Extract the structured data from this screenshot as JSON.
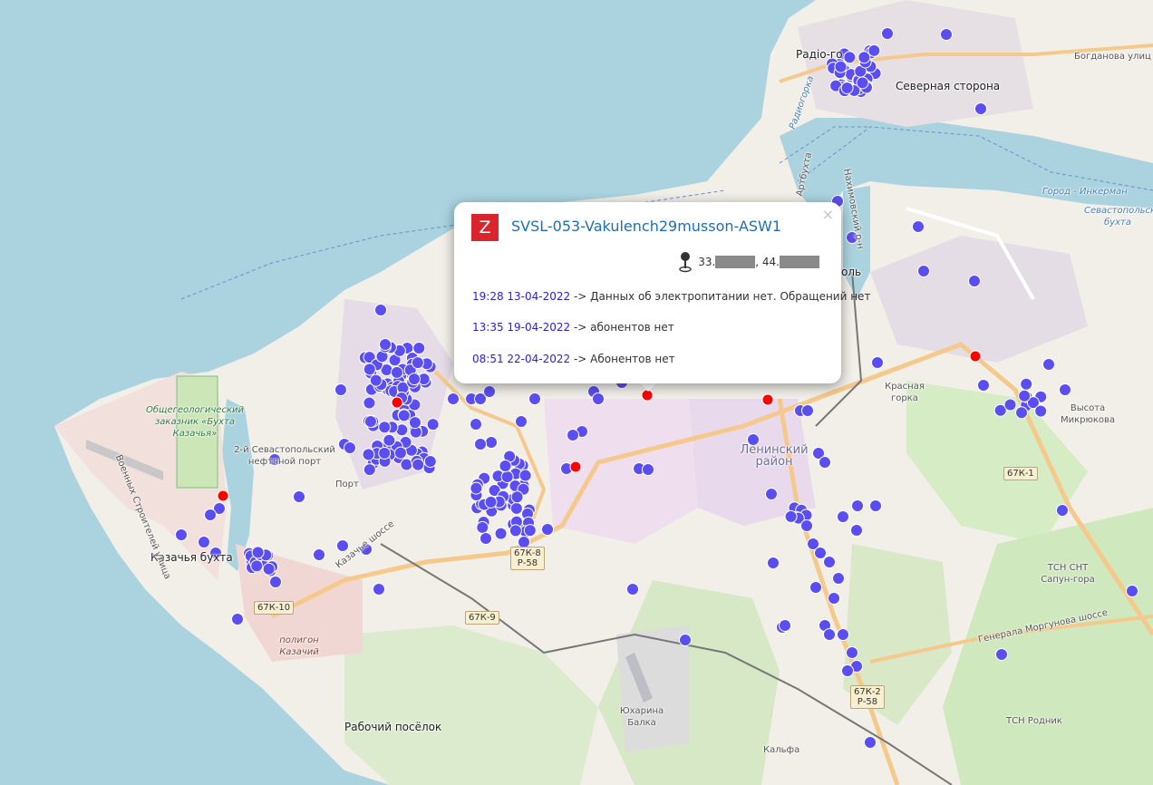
{
  "map": {
    "place_labels": [
      {
        "id": "radio-gorka",
        "text": "Радіо-го"
      },
      {
        "id": "severnaya-storona",
        "text": "Северная сторона"
      },
      {
        "id": "bogdanova",
        "text": "Богданова улиц"
      },
      {
        "id": "gorod-inkerman",
        "text": "Город - Инкерман"
      },
      {
        "id": "sevastopolskaya-bukhta",
        "text": "Севастопольская бухта"
      },
      {
        "id": "radiogorka-road",
        "text": "Радиогорка"
      },
      {
        "id": "arbukhta",
        "text": "Артбухта"
      },
      {
        "id": "nakhimovsky",
        "text": "Нахимовский р-н"
      },
      {
        "id": "sevastopol-partial",
        "text": "оль"
      },
      {
        "id": "krasnaya-gorka",
        "text": "Красная горка"
      },
      {
        "id": "vysota-mikryukova",
        "text": "Высота Микрюкова"
      },
      {
        "id": "leninsky",
        "text": "Ленинский район"
      },
      {
        "id": "zakaznik",
        "text": "Общегеологический заказник «Бухта Казачья»"
      },
      {
        "id": "port-2",
        "text": "2-й Севастопольский нефтяной порт"
      },
      {
        "id": "port",
        "text": "Порт"
      },
      {
        "id": "kazachya-bukhta",
        "text": "Казачья бухта"
      },
      {
        "id": "poligon",
        "text": "полигон Казачий"
      },
      {
        "id": "rabochy",
        "text": "Рабочий посёлок"
      },
      {
        "id": "yukharina",
        "text": "Юхарина Балка"
      },
      {
        "id": "kalfa",
        "text": "Кальфа"
      },
      {
        "id": "tsn-sapun",
        "text": "ТСН СНТ Сапун-гора"
      },
      {
        "id": "tsn-rodnik",
        "text": "ТСН Родник"
      },
      {
        "id": "generala-morgunova",
        "text": "Генерала Моргунова шоссе"
      },
      {
        "id": "kazachye-shosse",
        "text": "Казачье шоссе"
      },
      {
        "id": "voennykh-stroiteley",
        "text": "Военных Строителей улица"
      }
    ],
    "road_shields": [
      {
        "id": "67k8",
        "text": "67К-8\nР-58"
      },
      {
        "id": "67k9",
        "text": "67К-9"
      },
      {
        "id": "67k10",
        "text": "67К-10"
      },
      {
        "id": "67k1",
        "text": "67К-1"
      },
      {
        "id": "67k2",
        "text": "67К-2\nР-58"
      }
    ],
    "marker_colors": {
      "ok": "#5b4ef0",
      "alarm": "#ff0000"
    }
  },
  "popup": {
    "badge": "Z",
    "title": "SVSL-053-Vakulench29musson-ASW1",
    "lat_prefix": "33.",
    "lon_prefix": ", 44.",
    "close": "×",
    "log": [
      {
        "time": "19:28 13-04-2022",
        "arrow": " -> ",
        "text": "Данных об электропитании нет. Обращений нет"
      },
      {
        "time": "13:35 19-04-2022",
        "arrow": " -> ",
        "text": "абонентов нет"
      },
      {
        "time": "08:51 22-04-2022",
        "arrow": " -> ",
        "text": "Абонентов нет"
      }
    ]
  }
}
